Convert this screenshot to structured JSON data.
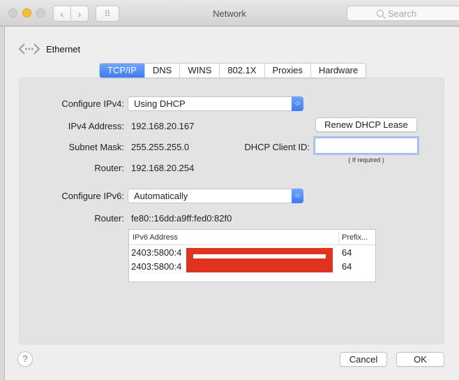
{
  "window": {
    "title": "Network",
    "search_placeholder": "Search",
    "nav_back": "‹",
    "nav_forward": "›",
    "grid_icon": "⠿"
  },
  "service": {
    "name": "Ethernet",
    "icon": "ethernet-icon"
  },
  "tabs": [
    {
      "label": "TCP/IP",
      "active": true
    },
    {
      "label": "DNS",
      "active": false
    },
    {
      "label": "WINS",
      "active": false
    },
    {
      "label": "802.1X",
      "active": false
    },
    {
      "label": "Proxies",
      "active": false
    },
    {
      "label": "Hardware",
      "active": false
    }
  ],
  "ipv4": {
    "configure_label": "Configure IPv4:",
    "configure_value": "Using DHCP",
    "address_label": "IPv4 Address:",
    "address_value": "192.168.20.167",
    "subnet_label": "Subnet Mask:",
    "subnet_value": "255.255.255.0",
    "router_label": "Router:",
    "router_value": "192.168.20.254",
    "renew_button": "Renew DHCP Lease",
    "client_id_label": "DHCP Client ID:",
    "client_id_value": "",
    "client_id_hint": "( If required )"
  },
  "ipv6": {
    "configure_label": "Configure IPv6:",
    "configure_value": "Automatically",
    "router_label": "Router:",
    "router_value": "fe80::16dd:a9ff:fed0:82f0",
    "table": {
      "columns": [
        "IPv6 Address",
        "Prefix..."
      ],
      "rows": [
        {
          "address": "2403:5800:4",
          "prefix": "64"
        },
        {
          "address": "2403:5800:4",
          "prefix": "64"
        }
      ],
      "redaction_color": "#e0331f"
    }
  },
  "footer": {
    "help": "?",
    "cancel": "Cancel",
    "ok": "OK"
  },
  "colors": {
    "accent": "#3d7bf5",
    "traffic_light_yellow": "#f5bf36"
  }
}
